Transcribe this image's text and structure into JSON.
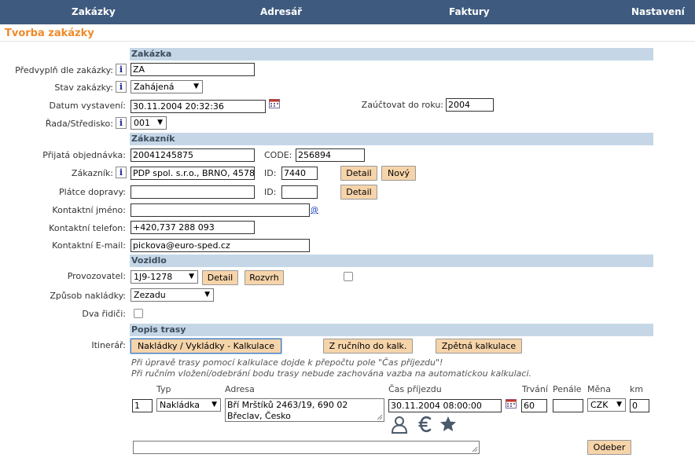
{
  "nav": {
    "zakazky": "Zakázky",
    "adresar": "Adresář",
    "faktury": "Faktury",
    "nastaveni": "Nastavení"
  },
  "page_title": "Tvorba zakázky",
  "info_glyph": "i",
  "zakazka": {
    "header": "Zakázka",
    "predvyplnit_label": "Předvyplň dle zakázky:",
    "predvyplnit_value": "ZA",
    "stav_label": "Stav zakázky:",
    "stav_value": "Zahájená",
    "datum_label": "Datum vystavení:",
    "datum_value": "30.11.2004 20:32:36",
    "zauctovat_label": "Zaúčtovat do roku:",
    "zauctovat_value": "2004",
    "rada_label": "Řada/Středisko:",
    "rada_value": "001"
  },
  "zakaznik": {
    "header": "Zákazník",
    "objednavka_label": "Přijatá objednávka:",
    "objednavka_value": "20041245875",
    "code_label": "CODE:",
    "code_value": "256894",
    "zakaznik_label": "Zákazník:",
    "zakaznik_value": "PDP spol. s.r.o., BRNO, 4578",
    "id_label": "ID:",
    "id_value": "7440",
    "detail_button": "Detail",
    "novy_button": "Nový",
    "platce_label": "Plátce dopravy:",
    "platce_value": "",
    "platce_id_value": "",
    "kontakt_jmeno_label": "Kontaktní jméno:",
    "kontakt_jmeno_value": "",
    "at_link": "@",
    "telefon_label": "Kontaktní telefon:",
    "telefon_value": "+420,737 288 093",
    "email_label": "Kontaktní E-mail:",
    "email_value": "pickova@euro-sped.cz"
  },
  "vozidlo": {
    "header": "Vozidlo",
    "provozovatel_label": "Provozovatel:",
    "provozovatel_value": "1J9-1278",
    "detail_button": "Detail",
    "rozvrh_button": "Rozvrh",
    "nakladky_label": "Způsob nakládky:",
    "nakladky_value": "Zezadu",
    "dva_ridici_label": "Dva řidiči:"
  },
  "trasa": {
    "header": "Popis trasy",
    "itinerar_label": "Itinerář:",
    "kalkulace_button": "Nakládky / Vykládky - Kalkulace",
    "rucniho_button": "Z ručního do kalk.",
    "zpetna_button": "Zpětná kalkulace",
    "note1": "Při úpravě trasy pomocí kalkulace dojde k přepočtu pole \"Čas příjezdu\"!",
    "note2": "Při ručním vložení/odebrání bodu trasy nebude zachována vazba na automatickou kalkulaci.",
    "columns": {
      "typ": "Typ",
      "adresa": "Adresa",
      "cas": "Čas příjezdu",
      "trvani": "Trvání",
      "penale": "Penále",
      "mena": "Měna",
      "km": "km"
    },
    "row": {
      "poradi": "1",
      "typ": "Nakládka",
      "adresa_line1": "Bří Mrštíků 2463/19, 690 02",
      "adresa_line2": "Břeclav, Česko",
      "cas": "30.11.2004 08:00:00",
      "trvani": "60",
      "penale": "",
      "mena": "CZK",
      "km": "0"
    },
    "odeber_button": "Odeber"
  }
}
